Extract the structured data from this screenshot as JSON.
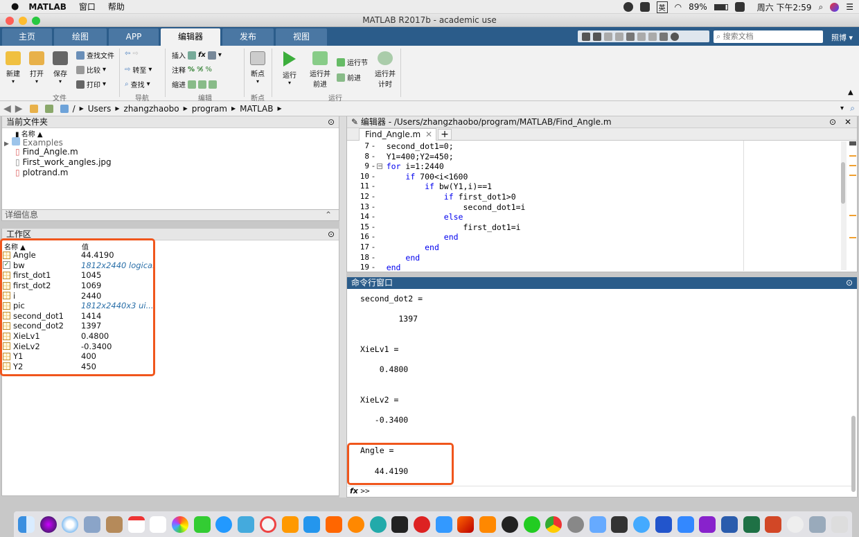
{
  "menubar": {
    "app": "MATLAB",
    "items": [
      "窗口",
      "帮助"
    ],
    "battery": "89%",
    "ime": "英",
    "datetime": "周六 下午2:59"
  },
  "window": {
    "title": "MATLAB R2017b - academic use"
  },
  "ribbon_tabs": [
    "主页",
    "绘图",
    "APP",
    "编辑器",
    "发布",
    "视图"
  ],
  "search": {
    "placeholder": "搜索文档"
  },
  "user": "照博",
  "ribbon": {
    "new": "新建",
    "open": "打开",
    "save": "保存",
    "find_files": "查找文件",
    "compare": "比较",
    "print": "打印",
    "goto": "转至",
    "find": "查找",
    "insert": "插入",
    "comment": "注释",
    "indent": "缩进",
    "breakpoints": "断点",
    "run": "运行",
    "run_advance": "运行并\n前进",
    "run_section": "运行节",
    "advance": "前进",
    "run_time": "运行并\n计时",
    "groups": [
      "文件",
      "导航",
      "编辑",
      "断点",
      "运行"
    ]
  },
  "path": [
    "/",
    "Users",
    "zhangzhaobo",
    "program",
    "MATLAB"
  ],
  "current_folder": {
    "title": "当前文件夹",
    "col": "名称 ▲",
    "items": [
      "Examples",
      "Find_Angle.m",
      "First_work_angles.jpg",
      "plotrand.m"
    ]
  },
  "details": {
    "title": "详细信息"
  },
  "workspace": {
    "title": "工作区",
    "col_name": "名称 ▲",
    "col_value": "值",
    "vars": [
      {
        "name": "Angle",
        "value": "44.4190",
        "type": "num"
      },
      {
        "name": "bw",
        "value": "1812x2440 logical",
        "type": "logical"
      },
      {
        "name": "first_dot1",
        "value": "1045",
        "type": "num"
      },
      {
        "name": "first_dot2",
        "value": "1069",
        "type": "num"
      },
      {
        "name": "i",
        "value": "2440",
        "type": "num"
      },
      {
        "name": "pic",
        "value": "1812x2440x3 ui...",
        "type": "uint"
      },
      {
        "name": "second_dot1",
        "value": "1414",
        "type": "num"
      },
      {
        "name": "second_dot2",
        "value": "1397",
        "type": "num"
      },
      {
        "name": "XieLv1",
        "value": "0.4800",
        "type": "num"
      },
      {
        "name": "XieLv2",
        "value": "-0.3400",
        "type": "num"
      },
      {
        "name": "Y1",
        "value": "400",
        "type": "num"
      },
      {
        "name": "Y2",
        "value": "450",
        "type": "num"
      }
    ]
  },
  "editor": {
    "title": "编辑器 - /Users/zhangzhaobo/program/MATLAB/Find_Angle.m",
    "tab": "Find_Angle.m",
    "lines": [
      {
        "n": "7",
        "t": "    second_dot1=0;"
      },
      {
        "n": "8",
        "t": "    Y1=400;Y2=450;"
      },
      {
        "n": "9",
        "t": "    for i=1:2440"
      },
      {
        "n": "10",
        "t": "        if 700<i<1600"
      },
      {
        "n": "11",
        "t": "            if bw(Y1,i)==1"
      },
      {
        "n": "12",
        "t": "                if first_dot1>0"
      },
      {
        "n": "13",
        "t": "                    second_dot1=i"
      },
      {
        "n": "14",
        "t": "                else"
      },
      {
        "n": "15",
        "t": "                    first_dot1=i"
      },
      {
        "n": "16",
        "t": "                end"
      },
      {
        "n": "17",
        "t": "            end"
      },
      {
        "n": "18",
        "t": "        end"
      },
      {
        "n": "19",
        "t": "    end"
      }
    ]
  },
  "command": {
    "title": "命令行窗口",
    "lines": [
      "second_dot2 =",
      "        1397",
      "XieLv1 =",
      "    0.4800",
      "XieLv2 =",
      "   -0.3400",
      "Angle =",
      "   44.4190"
    ],
    "prompt": ">>",
    "fx": "fx"
  }
}
